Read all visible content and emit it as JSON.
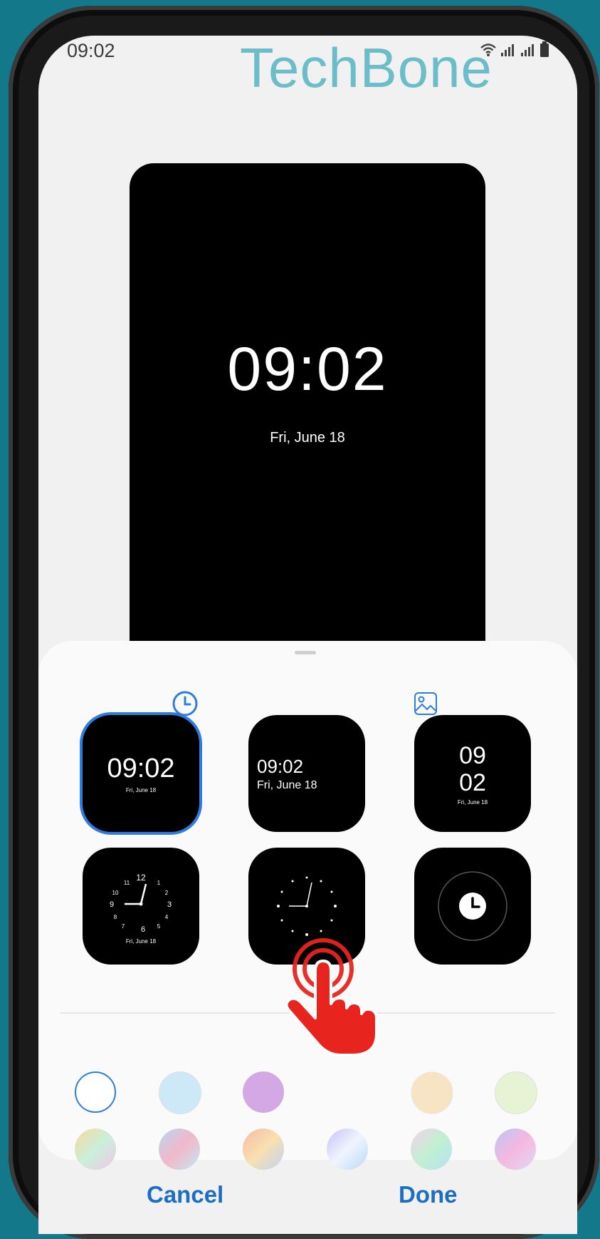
{
  "status_bar": {
    "time": "09:02",
    "icons": [
      "wifi-icon",
      "signal-icon",
      "signal-icon",
      "battery-icon"
    ]
  },
  "watermark": "TechBone",
  "preview": {
    "time": "09:02",
    "date": "Fri, June 18"
  },
  "tabs": [
    {
      "icon": "clock-icon",
      "selected": true
    },
    {
      "icon": "image-icon",
      "selected": false
    }
  ],
  "clock_styles": [
    {
      "style": "digital-centered",
      "time": "09:02",
      "date": "Fri, June 18",
      "selected": true
    },
    {
      "style": "digital-left",
      "time": "09:02",
      "date": "Fri, June 18",
      "selected": false
    },
    {
      "style": "digital-stacked",
      "hour": "09",
      "minute": "02",
      "date": "Fri, June 18",
      "selected": false
    },
    {
      "style": "analog-numbers",
      "date": "Fri, June 18",
      "selected": false
    },
    {
      "style": "analog-dots",
      "selected": false
    },
    {
      "style": "clock-icon-circle",
      "selected": false
    }
  ],
  "analog_numbers": [
    "12",
    "1",
    "2",
    "3",
    "4",
    "5",
    "6",
    "7",
    "8",
    "9",
    "10",
    "11"
  ],
  "colors": {
    "accent": "#2d7de0",
    "button_text": "#1c6ec2",
    "watermark": "#6bbdc9",
    "tap_indicator": "#e8241f",
    "swatches_row1": [
      "#ffffff",
      "#cde9f7",
      "#d4a8e4",
      "#ffffff",
      "#f7e4c4",
      "#e6f3d4"
    ],
    "swatches_row2": [
      "gradient-pastel-1",
      "gradient-pastel-2",
      "gradient-pastel-3",
      "gradient-pastel-4",
      "gradient-pastel-5",
      "gradient-pastel-6"
    ]
  },
  "actions": {
    "cancel": "Cancel",
    "done": "Done"
  }
}
